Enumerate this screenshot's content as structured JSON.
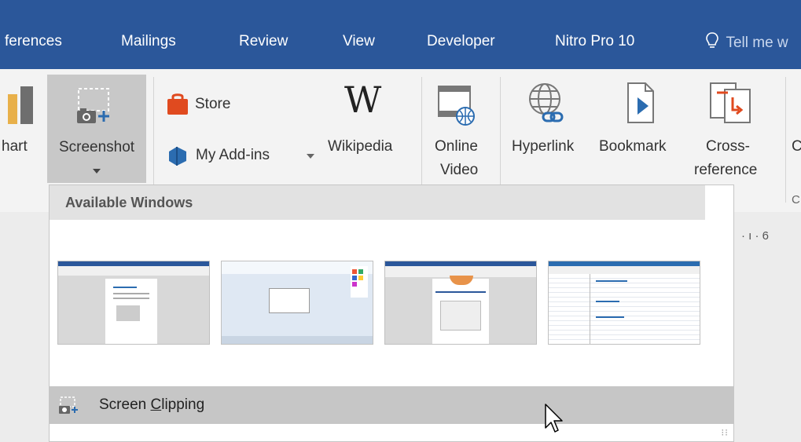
{
  "tabs": [
    "ferences",
    "Mailings",
    "Review",
    "View",
    "Developer",
    "Nitro Pro 10"
  ],
  "tell_me": "Tell me w",
  "ribbon": {
    "chart_label": "hart",
    "screenshot_label": "Screenshot",
    "store_label": "Store",
    "my_addins_label": "My Add-ins",
    "wikipedia_label": "Wikipedia",
    "online_video_line1": "Online",
    "online_video_line2": "Video",
    "hyperlink_label": "Hyperlink",
    "bookmark_label": "Bookmark",
    "cross_ref_line1": "Cross-",
    "cross_ref_line2": "reference",
    "cutoff_label": "C",
    "cutoff_label2": "C"
  },
  "ruler_text": "· ı · 6",
  "dropdown": {
    "header": "Available Windows",
    "thumbnails": [
      "window-1",
      "window-2",
      "window-3",
      "window-4"
    ],
    "clip_pre": "Screen ",
    "clip_underline": "C",
    "clip_post": "lipping"
  },
  "colors": {
    "tab_bar": "#2b579a",
    "ribbon_bg": "#f3f3f3",
    "selected_button": "#c8c8c8",
    "hover_row": "#c6c6c6",
    "store_red": "#e04a1f",
    "addins_blue": "#2b6cb0"
  },
  "icons": [
    "lightbulb-icon",
    "chart-icon",
    "screenshot-icon",
    "store-icon",
    "addins-icon",
    "wikipedia-icon",
    "online-video-icon",
    "hyperlink-icon",
    "bookmark-icon",
    "cross-reference-icon",
    "dropdown-arrow-icon",
    "cursor-icon"
  ]
}
